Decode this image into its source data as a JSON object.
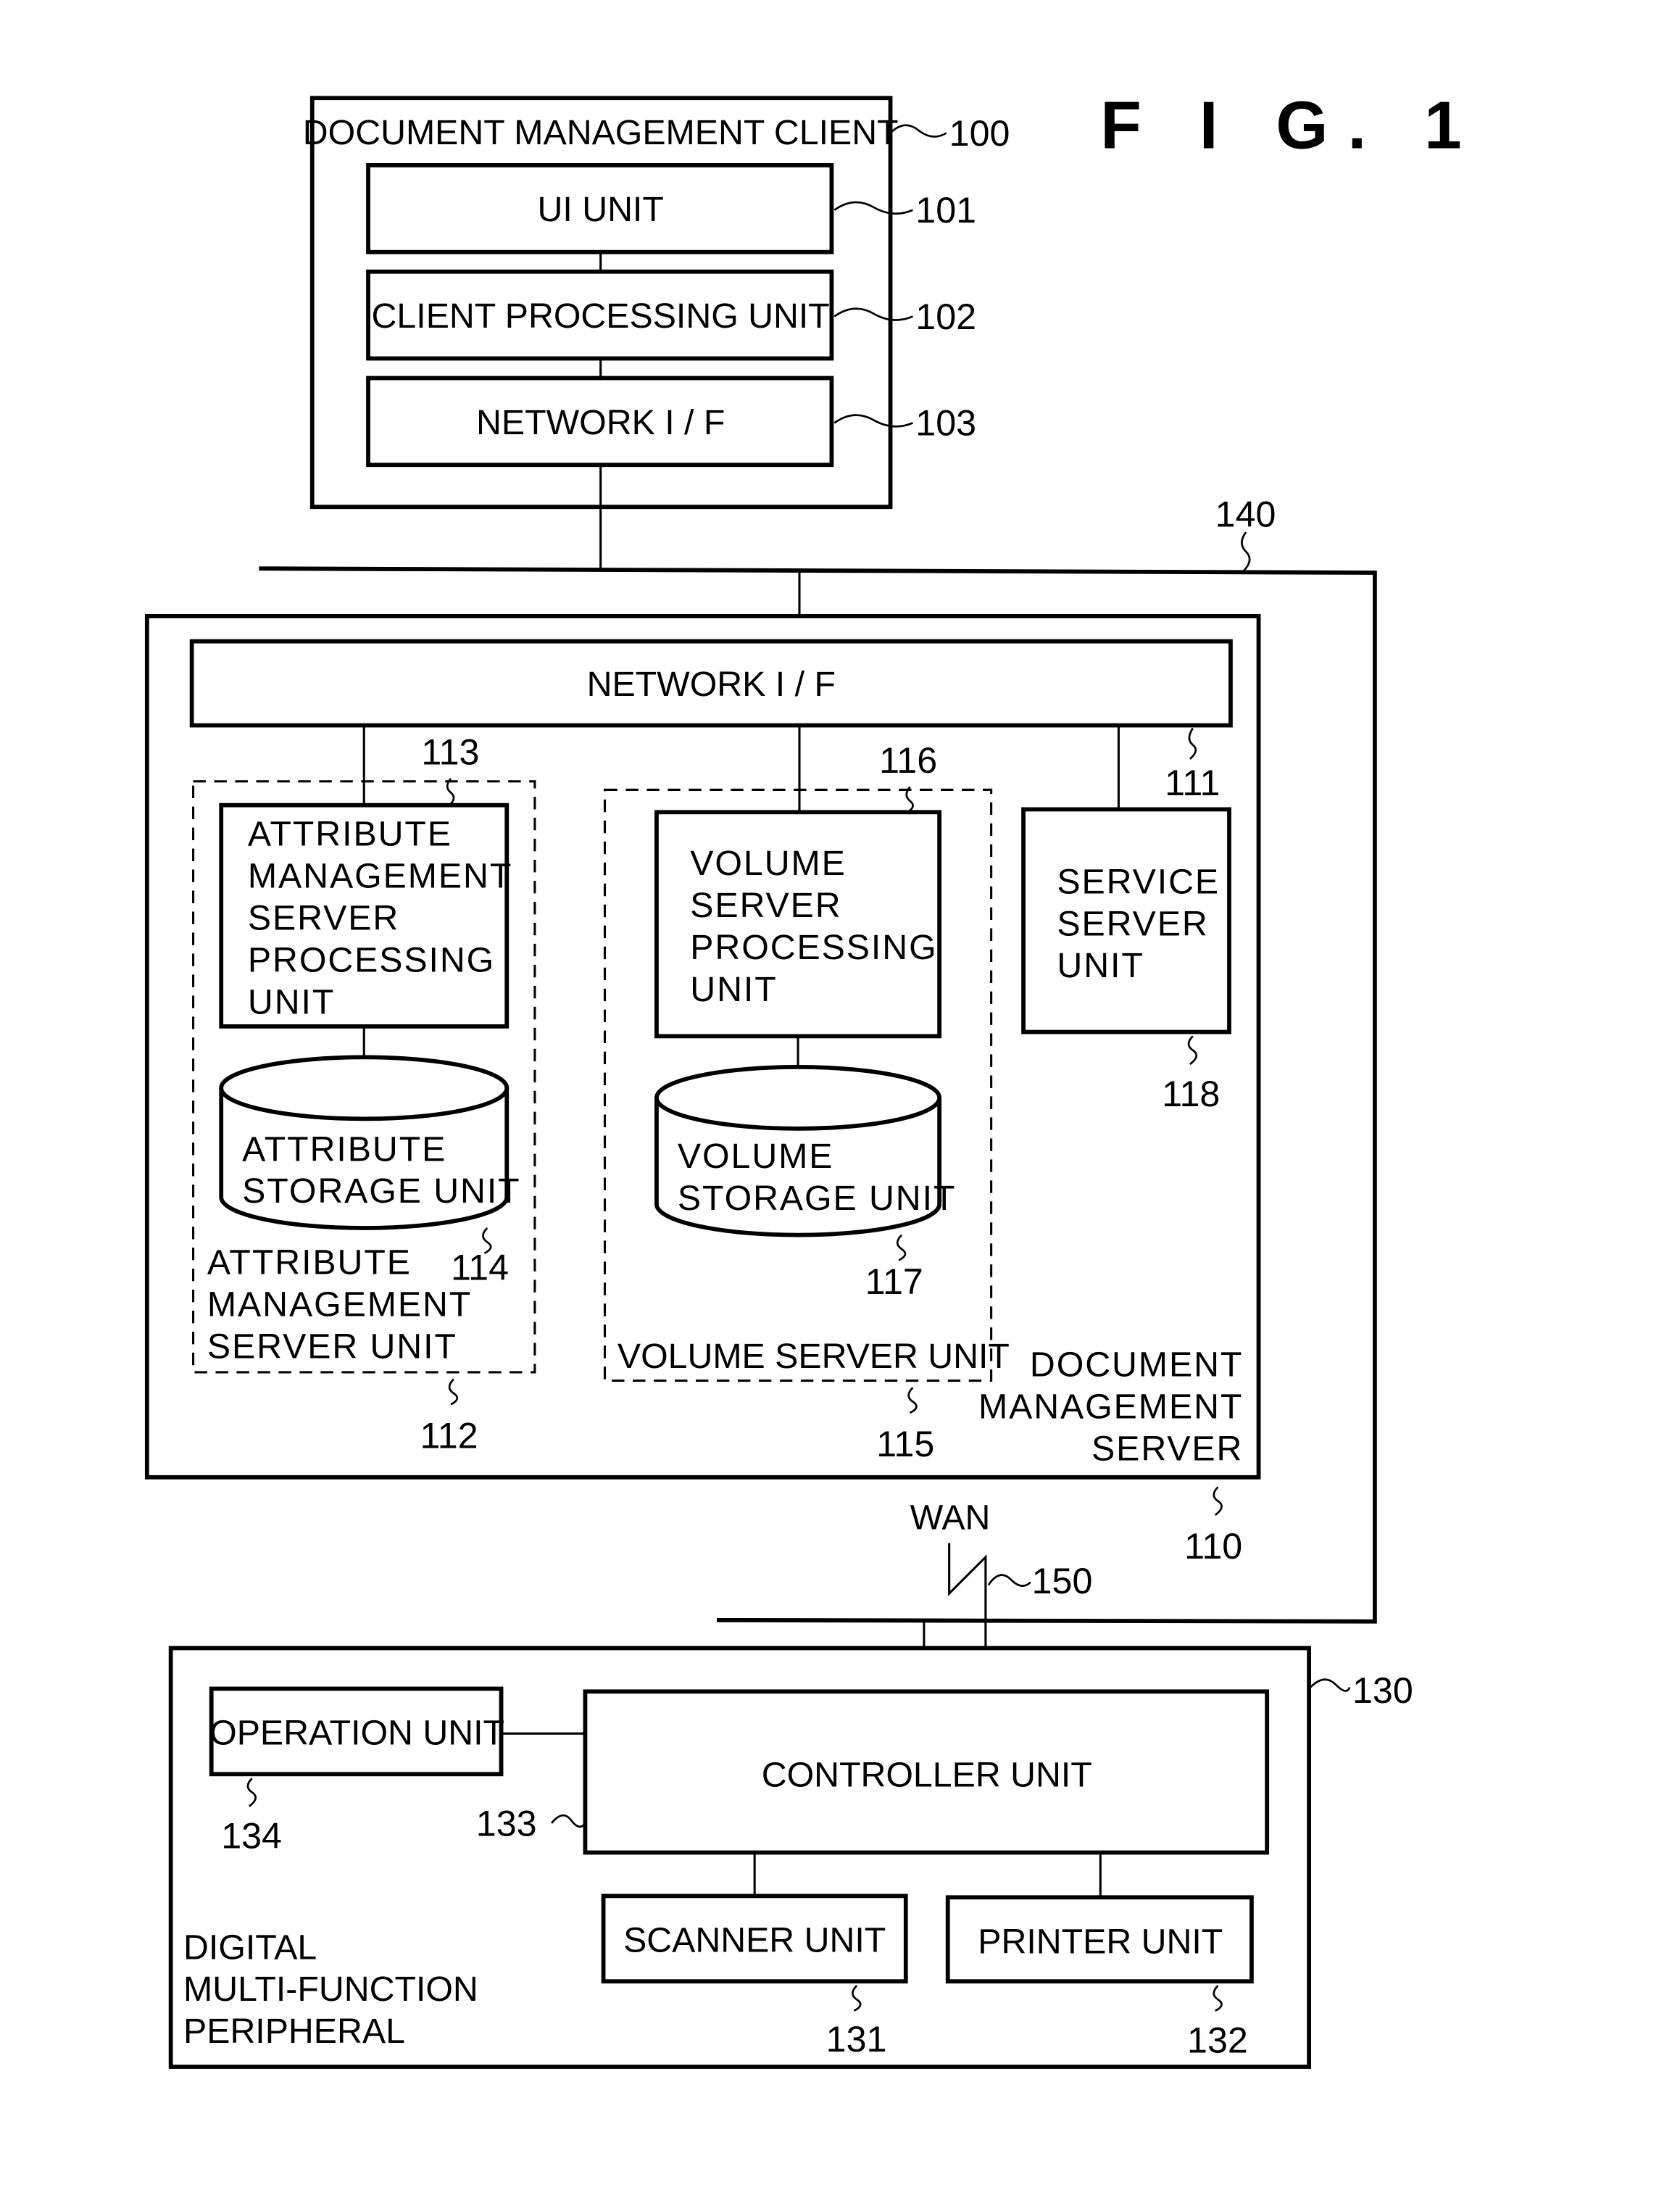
{
  "figure": {
    "title": "F I G. 1"
  },
  "client": {
    "title": "DOCUMENT MANAGEMENT CLIENT",
    "ref": "100",
    "ui_unit": {
      "label": "UI UNIT",
      "ref": "101"
    },
    "processing_unit": {
      "label": "CLIENT PROCESSING UNIT",
      "ref": "102"
    },
    "network_if": {
      "label": "NETWORK I / F",
      "ref": "103"
    }
  },
  "lan": {
    "ref": "140"
  },
  "server": {
    "title_lines": [
      "DOCUMENT",
      "MANAGEMENT",
      "SERVER"
    ],
    "ref": "110",
    "network_if": {
      "label": "NETWORK I / F",
      "ref": "111"
    },
    "attribute_unit": {
      "title_lines": [
        "ATTRIBUTE",
        "MANAGEMENT",
        "SERVER UNIT"
      ],
      "ref": "112",
      "processing": {
        "lines": [
          "ATTRIBUTE",
          "MANAGEMENT",
          "SERVER",
          "PROCESSING",
          "UNIT"
        ],
        "ref": "113"
      },
      "storage": {
        "lines": [
          "ATTRIBUTE",
          "STORAGE UNIT"
        ],
        "ref": "114"
      }
    },
    "volume_unit": {
      "title": "VOLUME SERVER UNIT",
      "ref": "115",
      "processing": {
        "lines": [
          "VOLUME",
          "SERVER",
          "PROCESSING",
          "UNIT"
        ],
        "ref": "116"
      },
      "storage": {
        "lines": [
          "VOLUME",
          "STORAGE UNIT"
        ],
        "ref": "117"
      }
    },
    "service_unit": {
      "lines": [
        "SERVICE",
        "SERVER",
        "UNIT"
      ],
      "ref": "118"
    }
  },
  "wan": {
    "label": "WAN",
    "ref": "150"
  },
  "mfp": {
    "title_lines": [
      "DIGITAL",
      "MULTI-FUNCTION",
      "PERIPHERAL"
    ],
    "ref": "130",
    "operation_unit": {
      "label": "OPERATION UNIT",
      "ref": "134"
    },
    "controller_unit": {
      "label": "CONTROLLER UNIT",
      "ref": "133"
    },
    "scanner_unit": {
      "label": "SCANNER UNIT",
      "ref": "131"
    },
    "printer_unit": {
      "label": "PRINTER UNIT",
      "ref": "132"
    }
  }
}
